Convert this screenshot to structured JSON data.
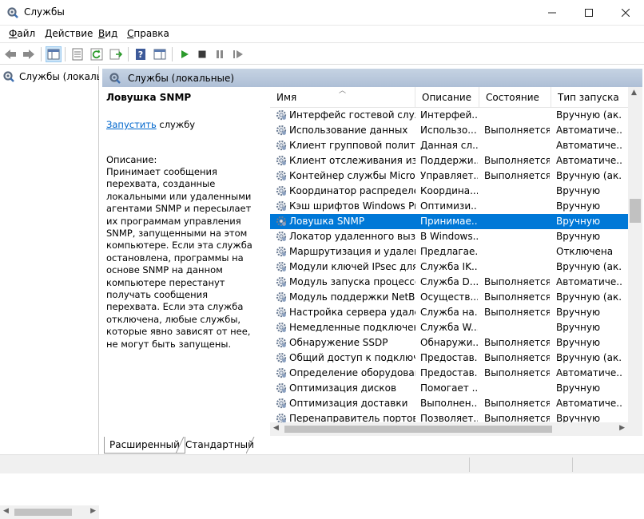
{
  "window": {
    "title": "Службы"
  },
  "menu": [
    {
      "label": "Файл",
      "key": "Ф",
      "rest": "айл"
    },
    {
      "label": "Действие",
      "key": "Д",
      "rest": "ействие"
    },
    {
      "label": "Вид",
      "key": "В",
      "rest": "ид"
    },
    {
      "label": "Справка",
      "key": "С",
      "rest": "правка"
    }
  ],
  "tree": {
    "item": "Службы (локалы"
  },
  "main": {
    "header": "Службы (локальные)",
    "service_title": "Ловушка SNMP",
    "start_link": "Запустить",
    "start_suffix": " службу",
    "description_label": "Описание:",
    "description": "Принимает сообщения перехвата, созданные локальными или удаленными агентами SNMP и пересылает их программам управления SNMP, запущенными на этом компьютере. Если эта служба остановлена, программы на основе SNMP на данном компьютере перестанут получать сообщения перехвата. Если эта служба отключена, любые службы, которые явно зависят от нее, не могут быть запущены."
  },
  "columns": {
    "name": "Имя",
    "description": "Описание",
    "status": "Состояние",
    "startup": "Тип запуска"
  },
  "services": [
    {
      "name": "Интерфейс гостевой служ...",
      "description": "Интерфей...",
      "status": "",
      "startup": "Вручную (ак..."
    },
    {
      "name": "Использование данных",
      "description": "Использо...",
      "status": "Выполняется",
      "startup": "Автоматиче..."
    },
    {
      "name": "Клиент групповой полити...",
      "description": "Данная сл...",
      "status": "",
      "startup": "Автоматиче..."
    },
    {
      "name": "Клиент отслеживания изм...",
      "description": "Поддержи...",
      "status": "Выполняется",
      "startup": "Автоматиче..."
    },
    {
      "name": "Контейнер службы Micros...",
      "description": "Управляет...",
      "status": "Выполняется",
      "startup": "Вручную (ак..."
    },
    {
      "name": "Координатор распределен...",
      "description": "Координа...",
      "status": "",
      "startup": "Вручную"
    },
    {
      "name": "Кэш шрифтов Windows Pr...",
      "description": "Оптимизи...",
      "status": "",
      "startup": "Вручную"
    },
    {
      "name": "Ловушка SNMP",
      "description": "Принимае...",
      "status": "",
      "startup": "Вручную",
      "selected": true
    },
    {
      "name": "Локатор удаленного вызо...",
      "description": "В Windows...",
      "status": "",
      "startup": "Вручную"
    },
    {
      "name": "Маршрутизация и удален...",
      "description": "Предлагае...",
      "status": "",
      "startup": "Отключена"
    },
    {
      "name": "Модули ключей IPsec для ...",
      "description": "Служба IK...",
      "status": "",
      "startup": "Вручную (ак..."
    },
    {
      "name": "Модуль запуска процессо...",
      "description": "Служба D...",
      "status": "Выполняется",
      "startup": "Автоматиче..."
    },
    {
      "name": "Модуль поддержки NetBI...",
      "description": "Осуществ...",
      "status": "Выполняется",
      "startup": "Вручную (ак..."
    },
    {
      "name": "Настройка сервера удален...",
      "description": "Служба на...",
      "status": "Выполняется",
      "startup": "Вручную"
    },
    {
      "name": "Немедленные подключен...",
      "description": "Служба W...",
      "status": "",
      "startup": "Вручную"
    },
    {
      "name": "Обнаружение SSDP",
      "description": "Обнаружи...",
      "status": "Выполняется",
      "startup": "Вручную"
    },
    {
      "name": "Общий доступ к подключ...",
      "description": "Предостав...",
      "status": "Выполняется",
      "startup": "Вручную (ак..."
    },
    {
      "name": "Определение оборудован...",
      "description": "Предостав...",
      "status": "Выполняется",
      "startup": "Автоматиче..."
    },
    {
      "name": "Оптимизация дисков",
      "description": "Помогает ...",
      "status": "",
      "startup": "Вручную"
    },
    {
      "name": "Оптимизация доставки",
      "description": "Выполнен...",
      "status": "Выполняется",
      "startup": "Автоматиче..."
    },
    {
      "name": "Перенаправитель портов ...",
      "description": "Позволяет...",
      "status": "Выполняется",
      "startup": "Вручную"
    }
  ],
  "tabs": [
    {
      "label": "Расширенный",
      "active": true
    },
    {
      "label": "Стандартный",
      "active": false
    }
  ],
  "colors": {
    "accent": "#0078d7",
    "header_bg": "#bccadd",
    "close_red": "#e81123",
    "play_green": "#2b9a2b"
  }
}
